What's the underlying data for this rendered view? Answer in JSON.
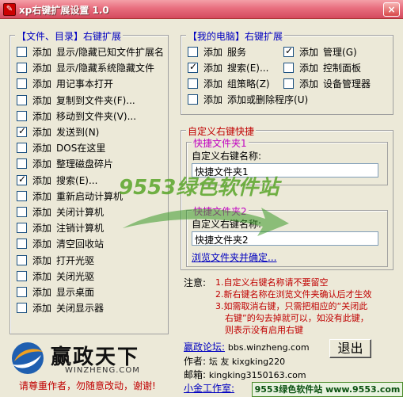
{
  "window": {
    "title": "xp右键扩展设置 1.0",
    "icon": "app-icon",
    "close": "×"
  },
  "left_group": {
    "legend": "【文件、目录】右键扩展",
    "items": [
      {
        "prefix": "添加",
        "label": "显示/隐藏已知文件扩展名",
        "checked": false
      },
      {
        "prefix": "添加",
        "label": "显示/隐藏系统隐藏文件",
        "checked": false
      },
      {
        "prefix": "添加",
        "label": "用记事本打开",
        "checked": false
      },
      {
        "prefix": "添加",
        "label": "复制到文件夹(F)...",
        "checked": false
      },
      {
        "prefix": "添加",
        "label": "移动到文件夹(V)...",
        "checked": false
      },
      {
        "prefix": "添加",
        "label": "发送到(N)",
        "checked": true
      },
      {
        "prefix": "添加",
        "label": "DOS在这里",
        "checked": false
      },
      {
        "prefix": "添加",
        "label": "整理磁盘碎片",
        "checked": false
      },
      {
        "prefix": "添加",
        "label": "搜索(E)...",
        "checked": true
      },
      {
        "prefix": "添加",
        "label": "重新启动计算机",
        "checked": false
      },
      {
        "prefix": "添加",
        "label": "关闭计算机",
        "checked": false
      },
      {
        "prefix": "添加",
        "label": "注销计算机",
        "checked": false
      },
      {
        "prefix": "添加",
        "label": "清空回收站",
        "checked": false
      },
      {
        "prefix": "添加",
        "label": "打开光驱",
        "checked": false
      },
      {
        "prefix": "添加",
        "label": "关闭光驱",
        "checked": false
      },
      {
        "prefix": "添加",
        "label": "显示桌面",
        "checked": false
      },
      {
        "prefix": "添加",
        "label": "关闭显示器",
        "checked": false
      }
    ]
  },
  "right_group": {
    "legend": "【我的电脑】右键扩展",
    "items": [
      {
        "prefix": "添加",
        "label": "服务",
        "checked": false
      },
      {
        "prefix": "添加",
        "label": "管理(G)",
        "checked": true
      },
      {
        "prefix": "添加",
        "label": "搜索(E)...",
        "checked": true
      },
      {
        "prefix": "添加",
        "label": "控制面板",
        "checked": false
      },
      {
        "prefix": "添加",
        "label": "组策略(Z)",
        "checked": false
      },
      {
        "prefix": "添加",
        "label": "设备管理器",
        "checked": false
      },
      {
        "prefix": "添加",
        "label": "添加或删除程序(U)",
        "checked": false
      }
    ]
  },
  "custom_group": {
    "legend": "自定义右键快捷",
    "folder1": {
      "legend": "快捷文件夹1",
      "name_label": "自定义右键名称:",
      "value": "快捷文件夹1"
    },
    "folder2": {
      "legend": "快捷文件夹2",
      "name_label": "自定义右键名称:",
      "value": "快捷文件夹2",
      "browse_link": "浏览文件夹并确定..."
    }
  },
  "notes": {
    "prefix": "注意:",
    "lines": [
      "1.自定义右键名称请不要留空",
      "2.新右键名称在浏览文件夹确认后才生效",
      "3.如需取消右键，只需把相应的“关闭此",
      "右键”的勾去掉就可以，如没有此键，",
      "则表示没有启用右键"
    ]
  },
  "footer": {
    "logo_text": "赢政天下",
    "logo_sub": "WINZHENG.COM",
    "slogan": "请尊重作者，勿随意改动，谢谢!",
    "forum_label": "赢政论坛:",
    "forum_url": "bbs.winzheng.com",
    "author_label": "作者:",
    "author_value": "坛 友 kixgking220",
    "email_label": "邮箱:",
    "email_value": "kingking3150163.com",
    "studio_link": "小金工作室:",
    "exit_button": "退出",
    "watermark_bar": "9553绿色软件站 www.9553.com",
    "watermark_brand": "9553绿色软件站"
  }
}
